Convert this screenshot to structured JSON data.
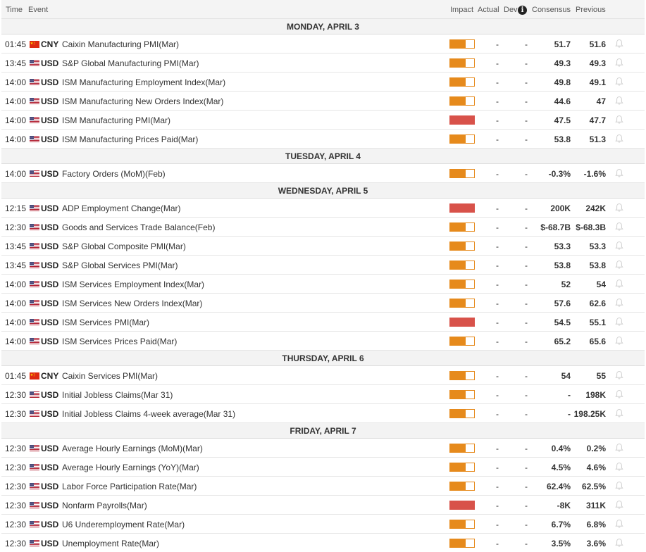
{
  "header": {
    "time": "Time",
    "event": "Event",
    "impact": "Impact",
    "actual": "Actual",
    "dev": "Dev",
    "info_glyph": "i",
    "consensus": "Consensus",
    "previous": "Previous"
  },
  "colors": {
    "impact_medium": "#e68a1c",
    "impact_high": "#d8524a"
  },
  "days": [
    {
      "label": "MONDAY, APRIL 3",
      "events": [
        {
          "time": "01:45",
          "flag": "cn-flag",
          "currency": "CNY",
          "name": "Caixin Manufacturing PMI(Mar)",
          "impact": "medium",
          "actual": "-",
          "dev": "-",
          "consensus": "51.7",
          "previous": "51.6"
        },
        {
          "time": "13:45",
          "flag": "us-flag",
          "currency": "USD",
          "name": "S&P Global Manufacturing PMI(Mar)",
          "impact": "medium",
          "actual": "-",
          "dev": "-",
          "consensus": "49.3",
          "previous": "49.3"
        },
        {
          "time": "14:00",
          "flag": "us-flag",
          "currency": "USD",
          "name": "ISM Manufacturing Employment Index(Mar)",
          "impact": "medium",
          "actual": "-",
          "dev": "-",
          "consensus": "49.8",
          "previous": "49.1"
        },
        {
          "time": "14:00",
          "flag": "us-flag",
          "currency": "USD",
          "name": "ISM Manufacturing New Orders Index(Mar)",
          "impact": "medium",
          "actual": "-",
          "dev": "-",
          "consensus": "44.6",
          "previous": "47"
        },
        {
          "time": "14:00",
          "flag": "us-flag",
          "currency": "USD",
          "name": "ISM Manufacturing PMI(Mar)",
          "impact": "high",
          "actual": "-",
          "dev": "-",
          "consensus": "47.5",
          "previous": "47.7"
        },
        {
          "time": "14:00",
          "flag": "us-flag",
          "currency": "USD",
          "name": "ISM Manufacturing Prices Paid(Mar)",
          "impact": "medium",
          "actual": "-",
          "dev": "-",
          "consensus": "53.8",
          "previous": "51.3"
        }
      ]
    },
    {
      "label": "TUESDAY, APRIL 4",
      "events": [
        {
          "time": "14:00",
          "flag": "us-flag",
          "currency": "USD",
          "name": "Factory Orders (MoM)(Feb)",
          "impact": "medium",
          "actual": "-",
          "dev": "-",
          "consensus": "-0.3%",
          "previous": "-1.6%"
        }
      ]
    },
    {
      "label": "WEDNESDAY, APRIL 5",
      "events": [
        {
          "time": "12:15",
          "flag": "us-flag",
          "currency": "USD",
          "name": "ADP Employment Change(Mar)",
          "impact": "high",
          "actual": "-",
          "dev": "-",
          "consensus": "200K",
          "previous": "242K"
        },
        {
          "time": "12:30",
          "flag": "us-flag",
          "currency": "USD",
          "name": "Goods and Services Trade Balance(Feb)",
          "impact": "medium",
          "actual": "-",
          "dev": "-",
          "consensus": "$-68.7B",
          "previous": "$-68.3B"
        },
        {
          "time": "13:45",
          "flag": "us-flag",
          "currency": "USD",
          "name": "S&P Global Composite PMI(Mar)",
          "impact": "medium",
          "actual": "-",
          "dev": "-",
          "consensus": "53.3",
          "previous": "53.3"
        },
        {
          "time": "13:45",
          "flag": "us-flag",
          "currency": "USD",
          "name": "S&P Global Services PMI(Mar)",
          "impact": "medium",
          "actual": "-",
          "dev": "-",
          "consensus": "53.8",
          "previous": "53.8"
        },
        {
          "time": "14:00",
          "flag": "us-flag",
          "currency": "USD",
          "name": "ISM Services Employment Index(Mar)",
          "impact": "medium",
          "actual": "-",
          "dev": "-",
          "consensus": "52",
          "previous": "54"
        },
        {
          "time": "14:00",
          "flag": "us-flag",
          "currency": "USD",
          "name": "ISM Services New Orders Index(Mar)",
          "impact": "medium",
          "actual": "-",
          "dev": "-",
          "consensus": "57.6",
          "previous": "62.6"
        },
        {
          "time": "14:00",
          "flag": "us-flag",
          "currency": "USD",
          "name": "ISM Services PMI(Mar)",
          "impact": "high",
          "actual": "-",
          "dev": "-",
          "consensus": "54.5",
          "previous": "55.1"
        },
        {
          "time": "14:00",
          "flag": "us-flag",
          "currency": "USD",
          "name": "ISM Services Prices Paid(Mar)",
          "impact": "medium",
          "actual": "-",
          "dev": "-",
          "consensus": "65.2",
          "previous": "65.6"
        }
      ]
    },
    {
      "label": "THURSDAY, APRIL 6",
      "events": [
        {
          "time": "01:45",
          "flag": "cn-flag",
          "currency": "CNY",
          "name": "Caixin Services PMI(Mar)",
          "impact": "medium",
          "actual": "-",
          "dev": "-",
          "consensus": "54",
          "previous": "55"
        },
        {
          "time": "12:30",
          "flag": "us-flag",
          "currency": "USD",
          "name": "Initial Jobless Claims(Mar 31)",
          "impact": "medium",
          "actual": "-",
          "dev": "-",
          "consensus": "-",
          "previous": "198K"
        },
        {
          "time": "12:30",
          "flag": "us-flag",
          "currency": "USD",
          "name": "Initial Jobless Claims 4-week average(Mar 31)",
          "impact": "medium",
          "actual": "-",
          "dev": "-",
          "consensus": "-",
          "previous": "198.25K"
        }
      ]
    },
    {
      "label": "FRIDAY, APRIL 7",
      "events": [
        {
          "time": "12:30",
          "flag": "us-flag",
          "currency": "USD",
          "name": "Average Hourly Earnings (MoM)(Mar)",
          "impact": "medium",
          "actual": "-",
          "dev": "-",
          "consensus": "0.4%",
          "previous": "0.2%"
        },
        {
          "time": "12:30",
          "flag": "us-flag",
          "currency": "USD",
          "name": "Average Hourly Earnings (YoY)(Mar)",
          "impact": "medium",
          "actual": "-",
          "dev": "-",
          "consensus": "4.5%",
          "previous": "4.6%"
        },
        {
          "time": "12:30",
          "flag": "us-flag",
          "currency": "USD",
          "name": "Labor Force Participation Rate(Mar)",
          "impact": "medium",
          "actual": "-",
          "dev": "-",
          "consensus": "62.4%",
          "previous": "62.5%"
        },
        {
          "time": "12:30",
          "flag": "us-flag",
          "currency": "USD",
          "name": "Nonfarm Payrolls(Mar)",
          "impact": "high",
          "actual": "-",
          "dev": "-",
          "consensus": "-8K",
          "previous": "311K"
        },
        {
          "time": "12:30",
          "flag": "us-flag",
          "currency": "USD",
          "name": "U6 Underemployment Rate(Mar)",
          "impact": "medium",
          "actual": "-",
          "dev": "-",
          "consensus": "6.7%",
          "previous": "6.8%"
        },
        {
          "time": "12:30",
          "flag": "us-flag",
          "currency": "USD",
          "name": "Unemployment Rate(Mar)",
          "impact": "medium",
          "actual": "-",
          "dev": "-",
          "consensus": "3.5%",
          "previous": "3.6%"
        }
      ]
    }
  ]
}
